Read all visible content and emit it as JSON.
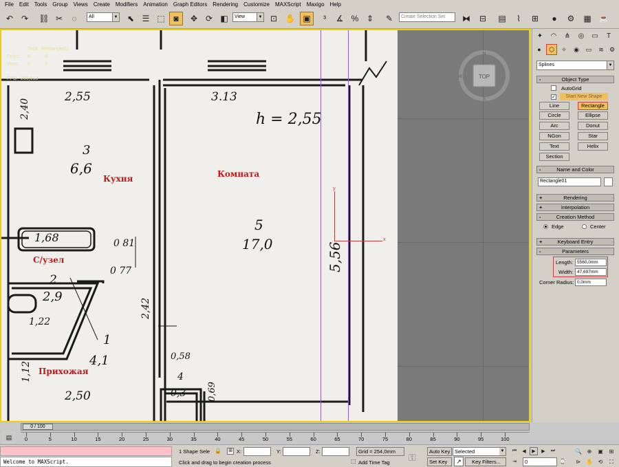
{
  "menu": [
    "File",
    "Edit",
    "Tools",
    "Group",
    "Views",
    "Create",
    "Modifiers",
    "Animation",
    "Graph Editors",
    "Rendering",
    "Customize",
    "MAXScript",
    "Maxigo",
    "Help"
  ],
  "toolbar": {
    "selection_filter": "All",
    "ref_coord": "View",
    "named_selection_placeholder": "Create Selection Set"
  },
  "viewport": {
    "stats": {
      "total_label": "Total",
      "total_value": "Rectangle01",
      "polys_label": "Polys:",
      "polys_value": "0",
      "verts_label": "Verts:",
      "verts_value": "0",
      "fps_label": "FPS:",
      "fps_value": "260,913"
    },
    "viewcube": {
      "face": "TOP",
      "n": "N",
      "s": "S",
      "w": "W"
    },
    "axes": {
      "x": "x",
      "y": "y"
    },
    "plan_dims": {
      "d255a": "2,55",
      "d313": "3.13",
      "h255": "h = 2,55",
      "d240": "2,40",
      "r3": "3",
      "a66": "6,6",
      "r5": "5",
      "a170": "17,0",
      "d556": "5,56",
      "d168": "1,68",
      "d081": "0 81",
      "d077": "0 77",
      "r2": "2",
      "a29": "2,9",
      "d122": "1,22",
      "d242": "2,42",
      "r1": "1",
      "a41": "4,1",
      "d058": "0,58",
      "r4": "4",
      "a03": "0,3",
      "d069": "0,69",
      "d112": "1,12",
      "d250": "2,50"
    },
    "labels": {
      "kitchen": "Кухня",
      "room": "Комната",
      "bathroom": "С/узел",
      "hallway": "Прихожая"
    }
  },
  "cmdpanel": {
    "category": "Splines",
    "object_type_title": "Object Type",
    "autogrid": "AutoGrid",
    "start_new_shape": "Start New Shape",
    "buttons": [
      "Line",
      "Rectangle",
      "Circle",
      "Ellipse",
      "Arc",
      "Donut",
      "NGon",
      "Star",
      "Text",
      "Helix",
      "Section"
    ],
    "name_color_title": "Name and Color",
    "object_name": "Rectangle01",
    "rendering": "Rendering",
    "interpolation": "Interpolation",
    "creation_method": "Creation Method",
    "edge": "Edge",
    "center": "Center",
    "keyboard_entry": "Keyboard Entry",
    "parameters": "Parameters",
    "length_label": "Length:",
    "length_value": "5560,0mm",
    "width_label": "Width:",
    "width_value": "47,697mm",
    "corner_label": "Corner Radius:",
    "corner_value": "0,0mm"
  },
  "timeline": {
    "frame": "0 / 100",
    "ticks": [
      "0",
      "5",
      "10",
      "15",
      "20",
      "25",
      "30",
      "35",
      "40",
      "45",
      "50",
      "55",
      "60",
      "65",
      "70",
      "75",
      "80",
      "85",
      "90",
      "95",
      "100"
    ]
  },
  "status": {
    "maxscript": "Welcome to MAXScript.",
    "selected_count": "1 Shape Sele",
    "x_label": "X:",
    "y_label": "Y:",
    "z_label": "Z:",
    "grid": "Grid = 254,0mm",
    "prompt": "Click and drag to begin creation process",
    "add_time_tag": "Add Time Tag",
    "auto_key": "Auto Key",
    "set_key": "Set Key",
    "selected": "Selected",
    "key_filters": "Key Filters...",
    "frame_value": "0"
  }
}
